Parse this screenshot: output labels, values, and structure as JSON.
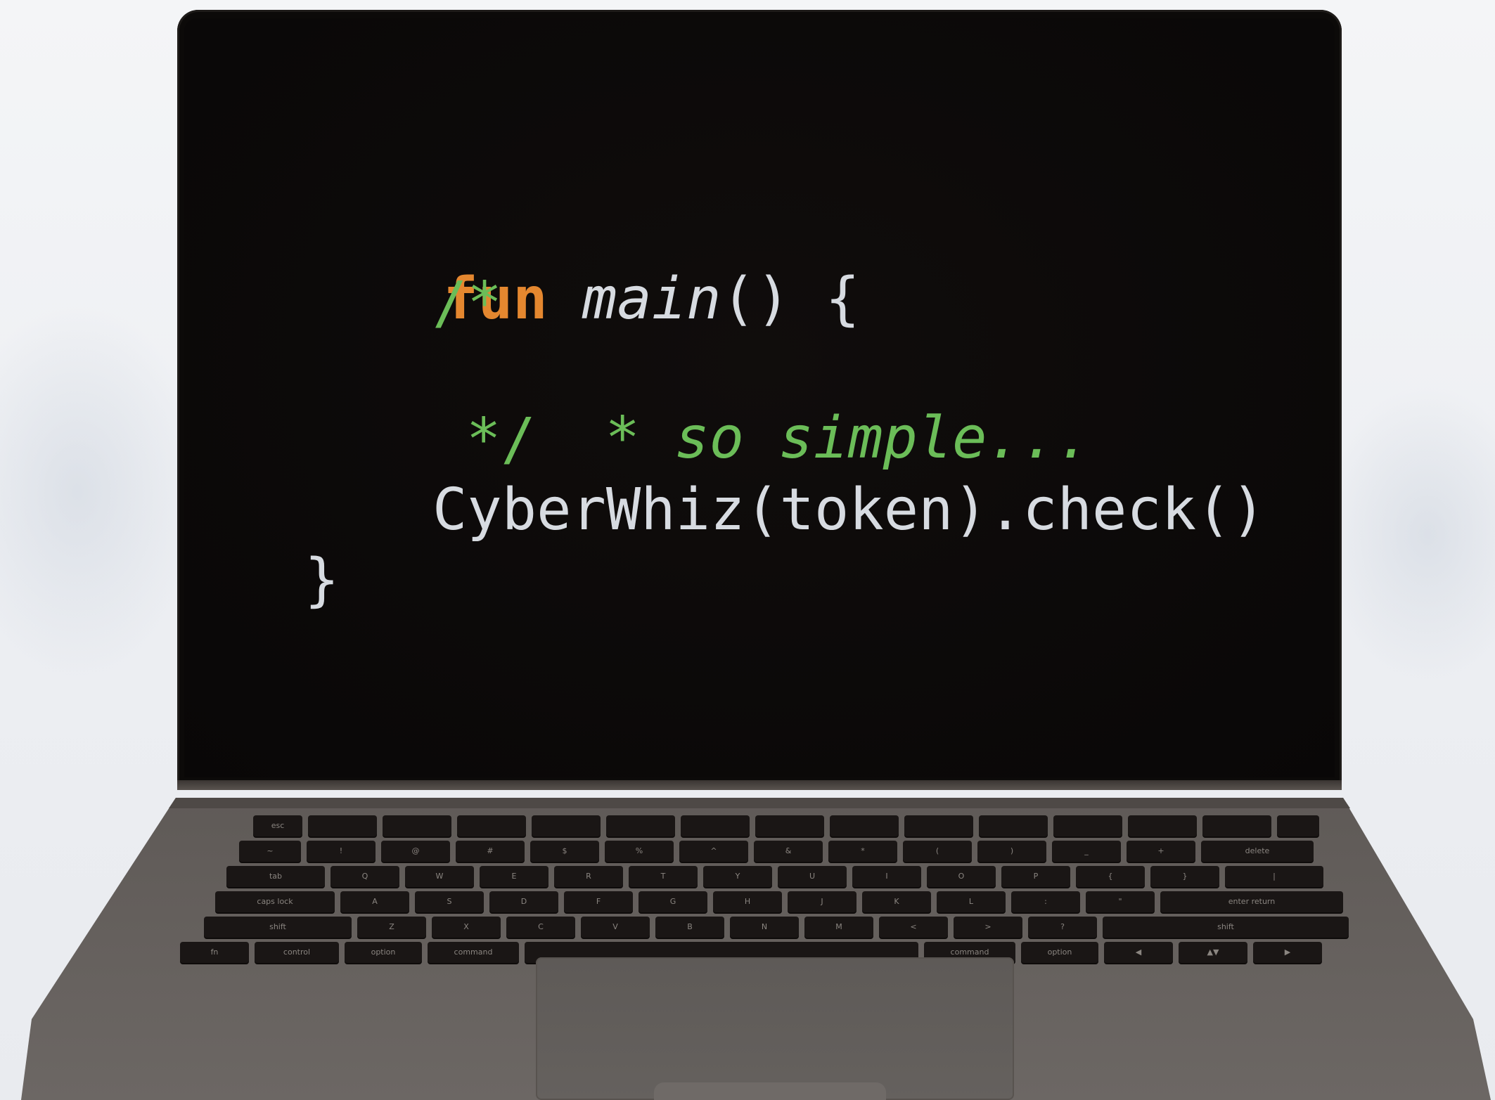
{
  "code": {
    "line1": {
      "keyword": "fun",
      "function": "main",
      "rest": "() {"
    },
    "line2": "/*",
    "line3": {
      "star": "*",
      "text": "so simple..."
    },
    "line4": "*/",
    "line5": "CyberWhiz(token).check()",
    "line6": "}"
  },
  "keyboard": {
    "row1": [
      "esc",
      "",
      "",
      "",
      "",
      "",
      "",
      "",
      "",
      "",
      "",
      "",
      "",
      "",
      ""
    ],
    "row2": [
      "~",
      "!",
      "@",
      "#",
      "$",
      "%",
      "^",
      "&",
      "*",
      "(",
      ")",
      "_",
      "+",
      "delete"
    ],
    "row3": [
      "tab",
      "Q",
      "W",
      "E",
      "R",
      "T",
      "Y",
      "U",
      "I",
      "O",
      "P",
      "{",
      "}",
      "|"
    ],
    "row4": [
      "caps lock",
      "A",
      "S",
      "D",
      "F",
      "G",
      "H",
      "J",
      "K",
      "L",
      ":",
      "\"",
      "enter return"
    ],
    "row5": [
      "shift",
      "Z",
      "X",
      "C",
      "V",
      "B",
      "N",
      "M",
      "<",
      ">",
      "?",
      "shift"
    ],
    "row6": [
      "fn",
      "control",
      "option",
      "command",
      "",
      "command",
      "option",
      "◀",
      "▲▼",
      "▶"
    ]
  },
  "colors": {
    "keyword": "#e4872f",
    "comment": "#6bbd58",
    "text": "#d7dbe1",
    "screen": "#0c0a09",
    "body": "#68635f"
  }
}
